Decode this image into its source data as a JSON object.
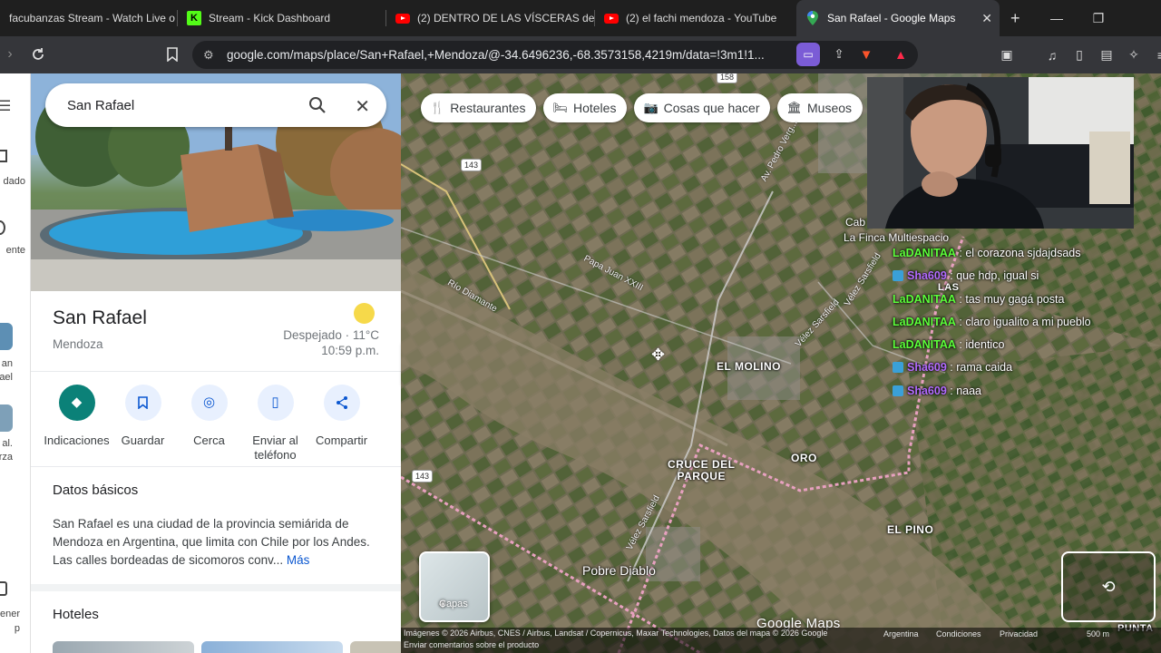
{
  "browser": {
    "tabs": [
      {
        "label": "facubanzas Stream - Watch Live o",
        "icon": "stream-icon",
        "active": false
      },
      {
        "label": "Stream - Kick Dashboard",
        "icon": "kick-icon",
        "active": false
      },
      {
        "label": "(2) DENTRO DE LAS VÍSCERAS de",
        "icon": "youtube-icon",
        "active": false
      },
      {
        "label": "(2) el fachi mendoza - YouTube",
        "icon": "youtube-icon",
        "active": false
      },
      {
        "label": "San Rafael - Google Maps",
        "icon": "maps-pin-icon",
        "active": true
      }
    ],
    "new_tab": "+",
    "url": "google.com/maps/place/San+Rafael,+Mendoza/@-34.6496236,-68.3573158,4219m/data=!3m1!1..."
  },
  "sidebar_rail": {
    "items": [
      "dado",
      "ente",
      "an\nael",
      "al.\nrza",
      "ener\np"
    ]
  },
  "panel": {
    "search_value": "San Rafael",
    "title": "San Rafael",
    "subtitle": "Mendoza",
    "weather": "Despejado · 11°C",
    "time": "10:59 p.m.",
    "actions": [
      {
        "label": "Indicaciones",
        "icon": "directions-icon"
      },
      {
        "label": "Guardar",
        "icon": "bookmark-icon"
      },
      {
        "label": "Cerca",
        "icon": "nearby-icon"
      },
      {
        "label": "Enviar al teléfono",
        "icon": "send-to-phone-icon"
      },
      {
        "label": "Compartir",
        "icon": "share-icon"
      }
    ],
    "basics_heading": "Datos básicos",
    "basics_text": "San Rafael es una ciudad de la provincia semiárida de Mendoza en Argentina, que limita con Chile por los Andes. Las calles bordeadas de sicomoros conv...",
    "basics_more": "Más",
    "hotels_heading": "Hoteles"
  },
  "map": {
    "chips": [
      {
        "label": "Restaurantes",
        "icon": "fork-knife-icon"
      },
      {
        "label": "Hoteles",
        "icon": "bed-icon"
      },
      {
        "label": "Cosas que hacer",
        "icon": "camera-icon"
      },
      {
        "label": "Museos",
        "icon": "museum-icon"
      }
    ],
    "places": [
      {
        "name": "EL MOLINO"
      },
      {
        "name": "CRUCE DEL\nPARQUE"
      },
      {
        "name": "ORO"
      },
      {
        "name": "EL PINO"
      },
      {
        "name": "Pobre Diablo"
      },
      {
        "name": "La Finca Multiespacio"
      },
      {
        "name": "Cab"
      },
      {
        "name": "LAS"
      },
      {
        "name": "PUNTA"
      }
    ],
    "roads": {
      "papa": "Papa Juan XXIII",
      "rio": "Río Diamante",
      "velez1": "Vélez Sarsfield",
      "velez2": "Vélez Sarsfield",
      "pedro": "Av. Pedro Verg...",
      "velez3": "Vélez Sarsfield",
      "r143a": "143",
      "r143b": "143",
      "r158": "158"
    },
    "layers_label": "Capas",
    "attribution": "Imágenes © 2026 Airbus, CNES / Airbus, Landsat / Copernicus, Maxar Technologies, Datos del mapa © 2026 Google",
    "attr_country": "Argentina",
    "attr_terms": "Condiciones",
    "attr_privacy": "Privacidad",
    "attr_feedback": "Enviar comentarios sobre el producto",
    "scale": "500 m",
    "google_logo": "Google Maps"
  },
  "chat": [
    {
      "user": "LaDANITAA",
      "color": "#5cff3a",
      "badge": false,
      "msg": "el corazona sjdajdsads"
    },
    {
      "user": "Sha609",
      "color": "#b36bff",
      "badge": true,
      "msg": "que hdp, igual si"
    },
    {
      "user": "LaDANITAA",
      "color": "#5cff3a",
      "badge": false,
      "msg": "tas muy gagá posta"
    },
    {
      "user": "LaDANITAA",
      "color": "#5cff3a",
      "badge": false,
      "msg": "claro igualito a mi pueblo"
    },
    {
      "user": "LaDANITAA",
      "color": "#5cff3a",
      "badge": false,
      "msg": "identico"
    },
    {
      "user": "Sha609",
      "color": "#b36bff",
      "badge": true,
      "msg": "rama caida"
    },
    {
      "user": "Sha609",
      "color": "#b36bff",
      "badge": true,
      "msg": "naaa"
    }
  ]
}
